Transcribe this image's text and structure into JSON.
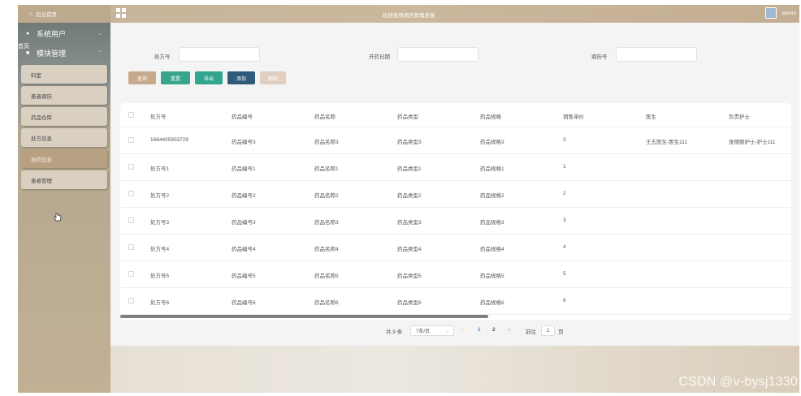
{
  "topbar": {
    "home_label": "后台首页",
    "title": "欢迎使用病历管理系统",
    "username": "admin"
  },
  "sidebar": {
    "system_users": "系统用户",
    "overlay_tag": "首页",
    "modules": "模块管理",
    "items": [
      {
        "label": "科室",
        "active": false
      },
      {
        "label": "患者病历",
        "active": false
      },
      {
        "label": "药品仓库",
        "active": false
      },
      {
        "label": "处方信息",
        "active": false
      },
      {
        "label": "拾药信息",
        "active": true
      },
      {
        "label": "患者管理",
        "active": false
      }
    ]
  },
  "search": {
    "prescription_label": "处方号",
    "date_label": "开药日期",
    "record_label": "病历号",
    "prescription_value": "",
    "date_value": "",
    "record_value": ""
  },
  "buttons": {
    "query": "查询",
    "reset": "重置",
    "export": "导出",
    "add": "添加",
    "delete": "删除"
  },
  "colors": {
    "query": "#c7a98c",
    "reset": "#3aa58d",
    "export": "#32a58e",
    "add": "#2f5a7a",
    "delete": "#e1cfc0"
  },
  "table": {
    "headers": [
      "处方号",
      "药品编号",
      "药品名称",
      "药品类型",
      "药品规格",
      "销售单价",
      "医生",
      "负责护士"
    ],
    "rows": [
      [
        "1684405903729",
        "药品编号3",
        "药品名称3",
        "药品类型3",
        "药品规格3",
        "3",
        "王五医生-医生111",
        "张丽丽护士-护士111"
      ],
      [
        "处方号1",
        "药品编号1",
        "药品名称1",
        "药品类型1",
        "药品规格1",
        "1",
        "",
        ""
      ],
      [
        "处方号2",
        "药品编号2",
        "药品名称2",
        "药品类型2",
        "药品规格2",
        "2",
        "",
        ""
      ],
      [
        "处方号3",
        "药品编号3",
        "药品名称3",
        "药品类型3",
        "药品规格3",
        "3",
        "",
        ""
      ],
      [
        "处方号4",
        "药品编号4",
        "药品名称4",
        "药品类型4",
        "药品规格4",
        "4",
        "",
        ""
      ],
      [
        "处方号5",
        "药品编号5",
        "药品名称5",
        "药品类型5",
        "药品规格5",
        "5",
        "",
        ""
      ],
      [
        "处方号6",
        "药品编号6",
        "药品名称6",
        "药品类型6",
        "药品规格6",
        "6",
        "",
        ""
      ]
    ]
  },
  "pagination": {
    "total": "共 9 条",
    "page_size": "7条/页",
    "prev": "‹",
    "pages": [
      "1",
      "2"
    ],
    "next": "›",
    "goto_label": "前往",
    "goto_value": "1",
    "page_suffix": "页"
  },
  "watermark": "CSDN @v-bysj1330"
}
